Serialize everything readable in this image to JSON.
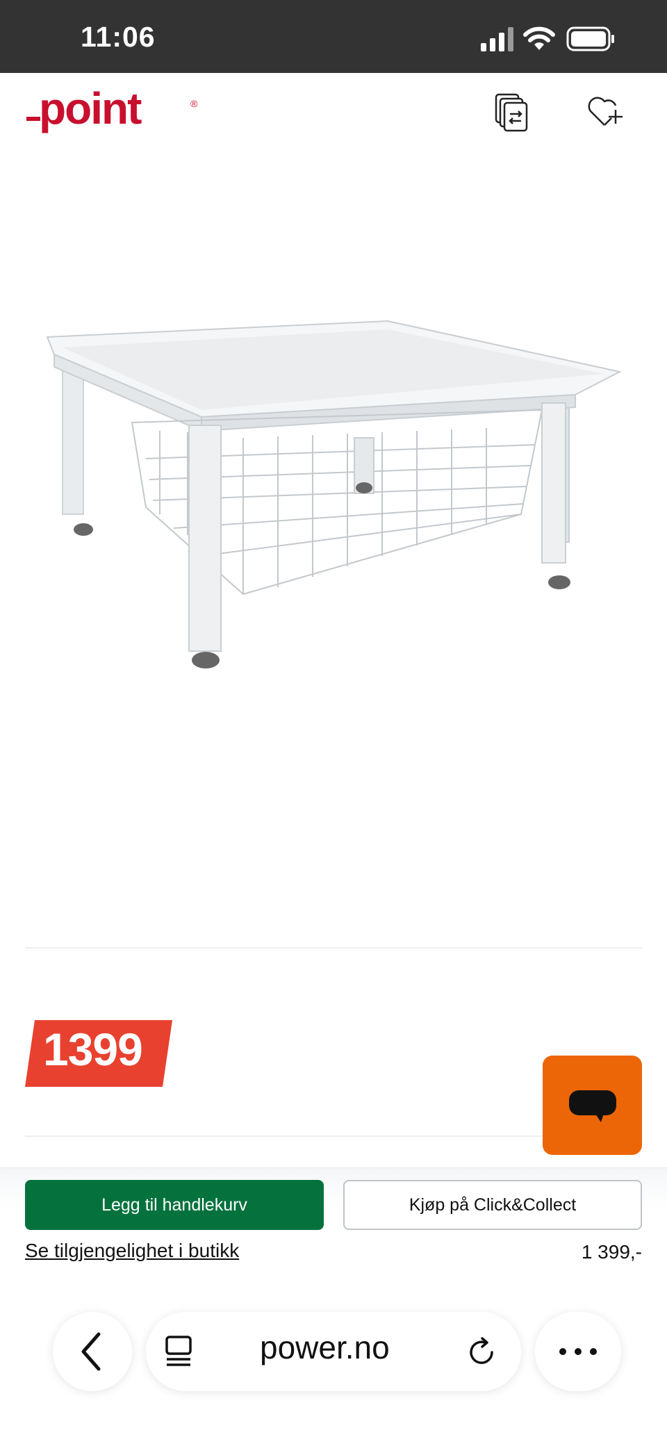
{
  "status_bar": {
    "time": "11:06"
  },
  "header": {
    "logo_text": "point",
    "logo_mark": "®"
  },
  "product": {
    "image_alt": "Vaskemaskinsokkel med kurv",
    "price": "1399"
  },
  "actions": {
    "add_to_cart": "Legg til handlekurv",
    "click_collect": "Kjøp på Click&Collect",
    "store_availability": "Se tilgjengelighet i butikk",
    "price_label": "1 399,-"
  },
  "browser": {
    "url": "power.no"
  },
  "colors": {
    "brand_red": "#c8102e",
    "price_red": "#e8412f",
    "cart_green": "#05723e",
    "chat_orange": "#ec6608"
  }
}
